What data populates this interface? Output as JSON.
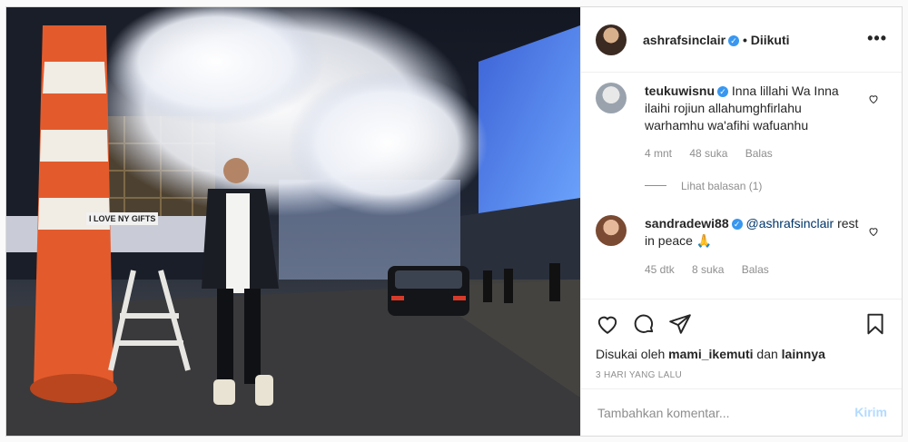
{
  "post": {
    "username": "ashrafsinclair",
    "follow_status": "• Diikuti",
    "more_icon": "more-dots-icon"
  },
  "photo": {
    "signs": [
      "I LOVE NY GIFTS"
    ]
  },
  "comments": [
    {
      "username": "teukuwisnu",
      "text": "Inna lillahi Wa Inna ilaihi rojiun allahumghfirlahu warhamhu wa'afihi wafuanhu",
      "time": "4 mnt",
      "likes": "48 suka",
      "reply": "Balas",
      "view_replies": "Lihat balasan (1)"
    },
    {
      "username": "sandradewi88",
      "mention": "@ashrafsinclair",
      "text": "rest in peace 🙏",
      "time": "45 dtk",
      "likes": "8 suka",
      "reply": "Balas"
    }
  ],
  "likes_line": {
    "prefix": "Disukai oleh",
    "user": "mami_ikemuti",
    "joiner": "dan",
    "others": "lainnya"
  },
  "timestamp": "3 HARI YANG LALU",
  "add_comment": {
    "placeholder": "Tambahkan komentar...",
    "submit": "Kirim"
  },
  "colors": {
    "verified": "#3897f0",
    "submit_disabled": "#b3dbff",
    "muted": "#8e8e8e"
  }
}
